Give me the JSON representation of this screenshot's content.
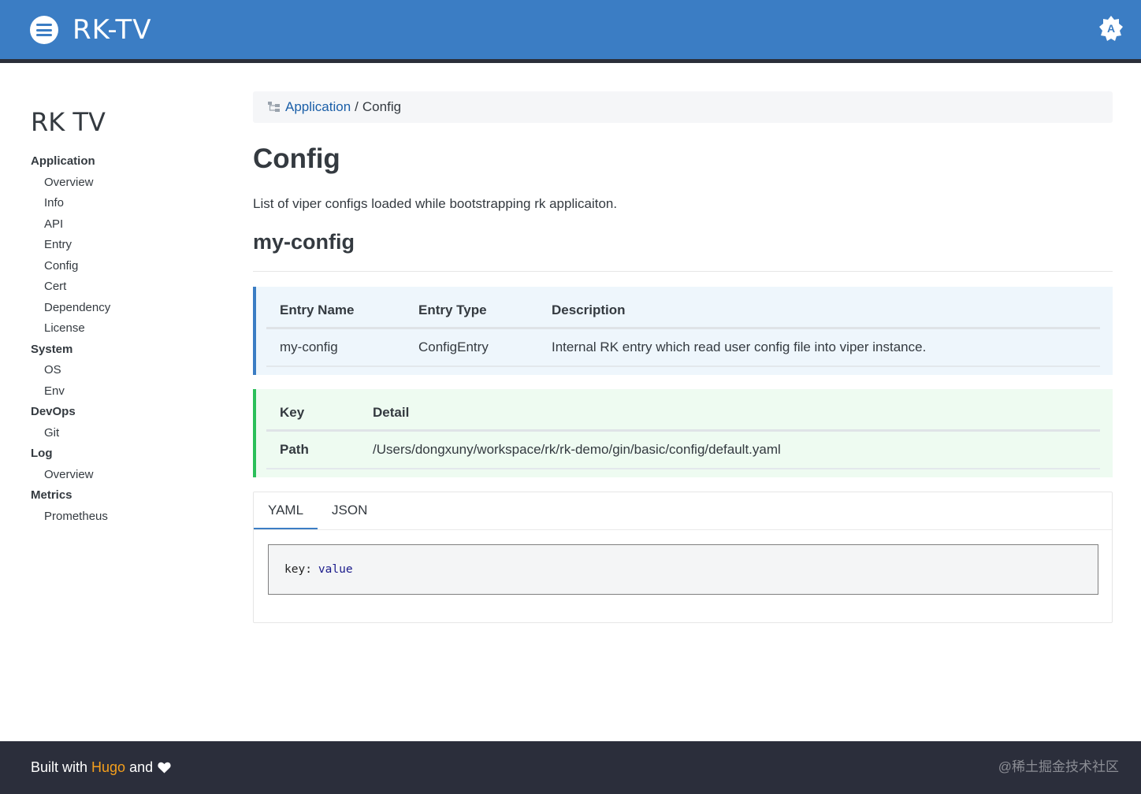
{
  "header": {
    "title": "RK-TV",
    "menu_icon": "menu-icon",
    "theme_icon": "auto-theme-icon",
    "theme_label": "A",
    "color": "#3b7dc4"
  },
  "sidebar": {
    "title": "RK TV",
    "sections": [
      {
        "label": "Application",
        "items": [
          "Overview",
          "Info",
          "API",
          "Entry",
          "Config",
          "Cert",
          "Dependency",
          "License"
        ]
      },
      {
        "label": "System",
        "items": [
          "OS",
          "Env"
        ]
      },
      {
        "label": "DevOps",
        "items": [
          "Git"
        ]
      },
      {
        "label": "Log",
        "items": [
          "Overview"
        ]
      },
      {
        "label": "Metrics",
        "items": [
          "Prometheus"
        ]
      }
    ]
  },
  "breadcrumb": {
    "icon": "sitemap-icon",
    "parent": "Application",
    "separator": "/",
    "current": "Config"
  },
  "main": {
    "title": "Config",
    "lead": "List of viper configs loaded while bootstrapping rk applicaiton.",
    "section_title": "my-config",
    "entry_table": {
      "headers": [
        "Entry Name",
        "Entry Type",
        "Description"
      ],
      "rows": [
        [
          "my-config",
          "ConfigEntry",
          "Internal RK entry which read user config file into viper instance."
        ]
      ]
    },
    "detail_table": {
      "headers": [
        "Key",
        "Detail"
      ],
      "rows": [
        [
          "Path",
          "/Users/dongxuny/workspace/rk/rk-demo/gin/basic/config/default.yaml"
        ]
      ]
    },
    "tabs": [
      {
        "label": "YAML",
        "active": true
      },
      {
        "label": "JSON",
        "active": false
      }
    ],
    "code": {
      "key": "key:",
      "value": "value"
    }
  },
  "footer": {
    "prefix": "Built with",
    "link": "Hugo",
    "suffix": "and",
    "heart_icon": "heart-icon",
    "watermark": "@稀土掘金技术社区",
    "link_color": "#f49f1c",
    "background": "#2b2e3b"
  }
}
